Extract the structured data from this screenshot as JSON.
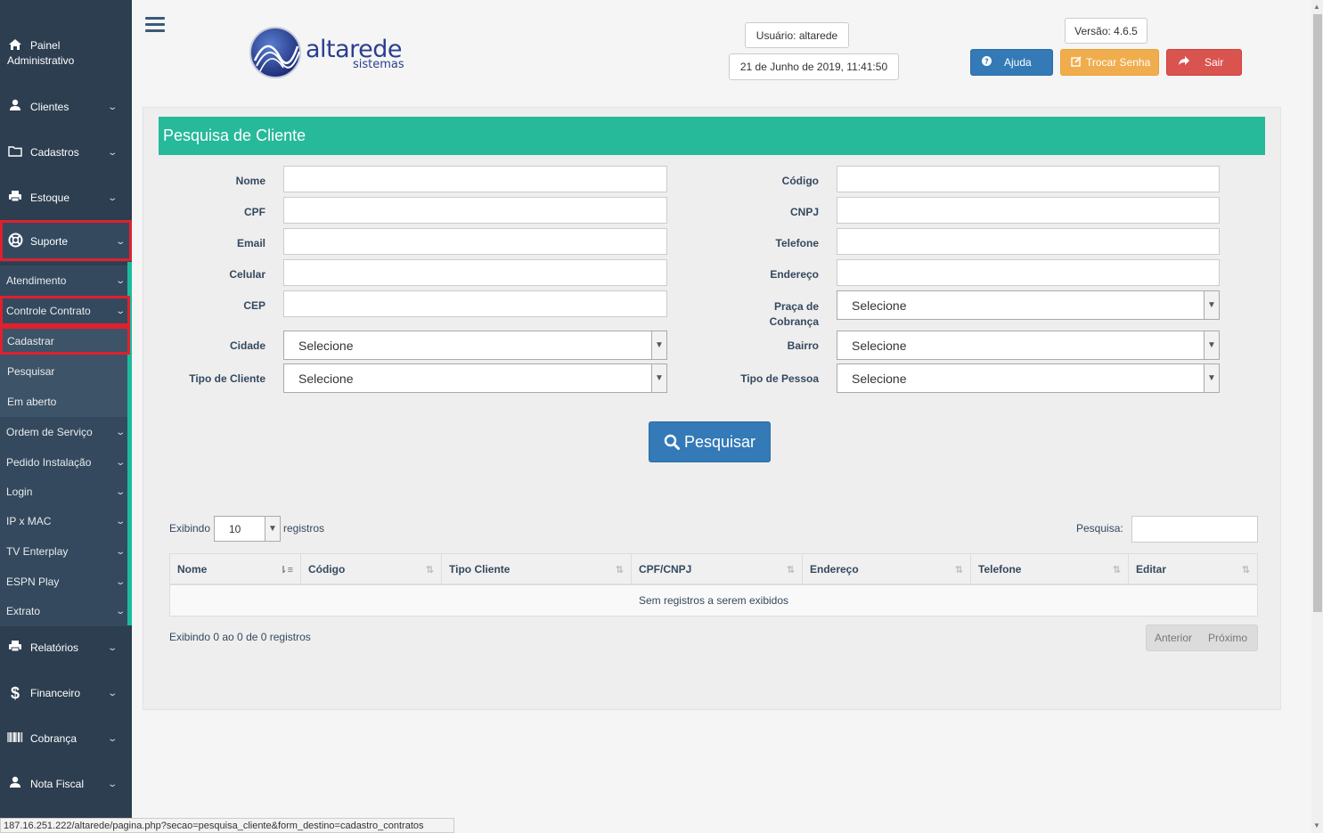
{
  "sidebar": {
    "painel": [
      "Painel",
      "Administrativo"
    ],
    "items": [
      {
        "label": "Clientes",
        "icon": "user-icon"
      },
      {
        "label": "Cadastros",
        "icon": "folder-icon"
      },
      {
        "label": "Estoque",
        "icon": "printer-icon"
      },
      {
        "label": "Suporte",
        "icon": "lifebuoy-icon"
      }
    ],
    "suporte_sub": [
      {
        "label": "Atendimento"
      },
      {
        "label": "Controle Contrato"
      }
    ],
    "contrato_sub": [
      {
        "label": "Cadastrar"
      },
      {
        "label": "Pesquisar"
      },
      {
        "label": "Em aberto"
      }
    ],
    "suporte_sub2": [
      {
        "label": "Ordem de Serviço"
      },
      {
        "label": "Pedido Instalação"
      },
      {
        "label": "Login"
      },
      {
        "label": "IP x MAC"
      },
      {
        "label": "TV Enterplay"
      },
      {
        "label": "ESPN Play"
      },
      {
        "label": "Extrato"
      }
    ],
    "items2": [
      {
        "label": "Relatórios",
        "icon": "printer-icon"
      },
      {
        "label": "Financeiro",
        "icon": "dollar-icon"
      },
      {
        "label": "Cobrança",
        "icon": "barcode-icon"
      },
      {
        "label": "Nota Fiscal",
        "icon": "user-icon"
      }
    ]
  },
  "header": {
    "logo_text": "altarede",
    "logo_sub": "sistemas",
    "usuario": "Usuário: altarede",
    "datetime": "21 de Junho de 2019, 11:41:50",
    "versao": "Versão: 4.6.5",
    "btn_ajuda": "Ajuda",
    "btn_trocar": "Trocar Senha",
    "btn_sair": "Sair",
    "colors": {
      "ajuda": "#337ab7",
      "trocar": "#f0ad4e",
      "sair": "#d9534f"
    }
  },
  "form": {
    "title": "Pesquisa de Cliente",
    "left_labels": [
      "Nome",
      "CPF",
      "Email",
      "Celular",
      "CEP"
    ],
    "right_labels": [
      "Código",
      "CNPJ",
      "Telefone",
      "Endereço"
    ],
    "praca_label": [
      "Praça de",
      "Cobrança"
    ],
    "praca_value": "Selecione",
    "cidade_label": "Cidade",
    "cidade_value": "Selecione",
    "bairro_label": "Bairro",
    "bairro_value": "Selecione",
    "tipo_cliente_label": "Tipo de Cliente",
    "tipo_cliente_value": "Selecione",
    "tipo_pessoa_label": "Tipo de Pessoa",
    "tipo_pessoa_value": "Selecione",
    "search_button": "Pesquisar"
  },
  "table": {
    "show_prefix": "Exibindo",
    "length_value": "10",
    "show_suffix": "registros",
    "search_label": "Pesquisa:",
    "columns": [
      "Nome",
      "Código",
      "Tipo Cliente",
      "CPF/CNPJ",
      "Endereço",
      "Telefone",
      "Editar"
    ],
    "empty": "Sem registros a serem exibidos",
    "info": "Exibindo 0 ao 0 de 0 registros",
    "prev": "Anterior",
    "next": "Próximo"
  },
  "statusbar": "187.16.251.222/altarede/pagina.php?secao=pesquisa_cliente&form_destino=cadastro_contratos"
}
